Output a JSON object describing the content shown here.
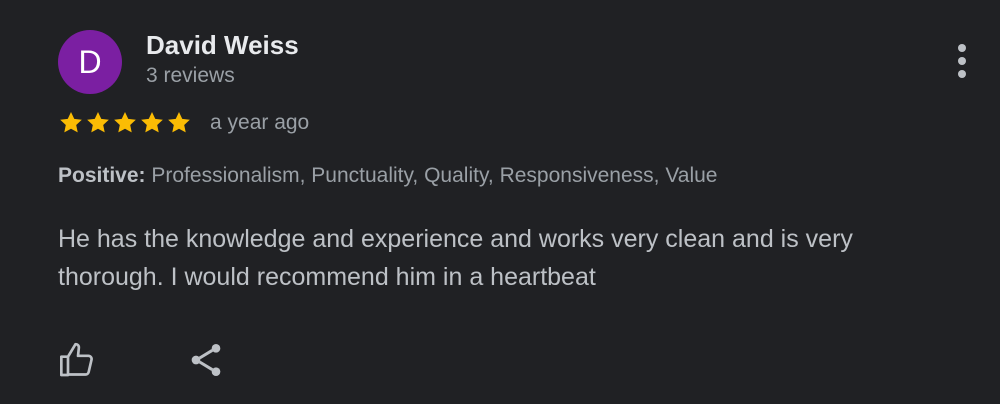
{
  "reviewer": {
    "initial": "D",
    "name": "David Weiss",
    "reviews_count": "3 reviews",
    "avatar_color": "#7b1fa2"
  },
  "rating": {
    "stars": 5,
    "max_stars": 5,
    "star_color": "#fbbc04",
    "time": "a year ago"
  },
  "tags": {
    "label": "Positive:",
    "values": "Professionalism, Punctuality, Quality, Responsiveness, Value"
  },
  "review_text": "He has the knowledge and experience and works very clean and is very thorough. I would recommend him in a heartbeat",
  "actions": {
    "like_icon": "thumb-up-icon",
    "share_icon": "share-icon",
    "more_icon": "more-vert-icon"
  }
}
